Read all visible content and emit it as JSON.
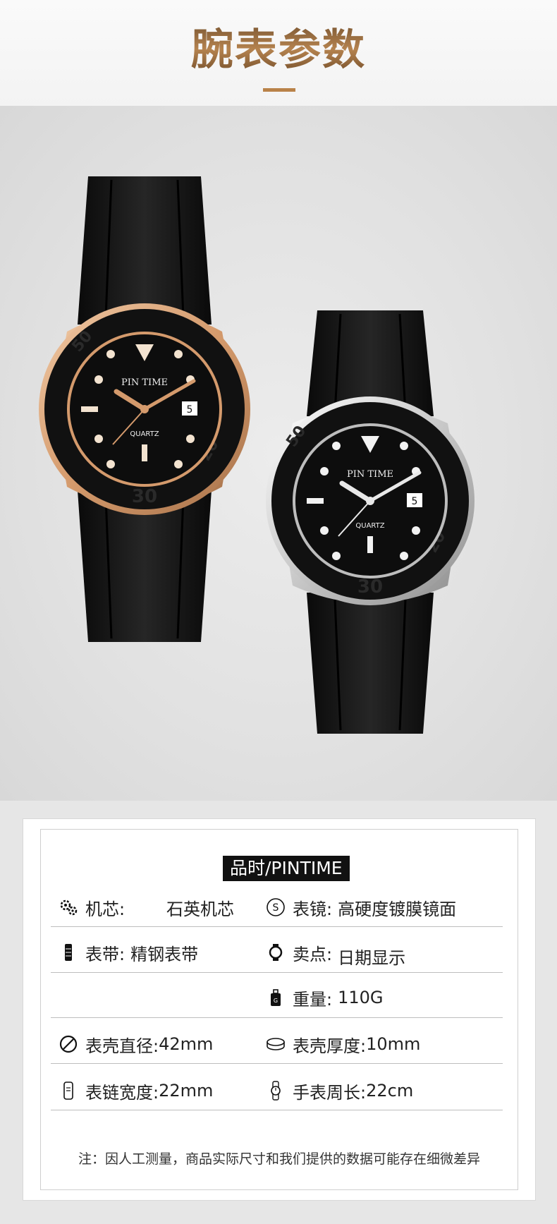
{
  "header": {
    "title": "腕表参数"
  },
  "watches": [
    {
      "name": "rose-gold-watch",
      "dial_brand": "PIN TIME",
      "dial_model": "QUARTZ",
      "date": "5"
    },
    {
      "name": "silver-watch",
      "dial_brand": "PIN TIME",
      "dial_model": "QUARTZ",
      "date": "5"
    }
  ],
  "specs": {
    "brand_label": "品时/PINTIME",
    "movement_label": "机芯:",
    "movement_value": "石英机芯",
    "mirror_label": "表镜:",
    "mirror_value": "高硬度镀膜镜面",
    "strap_label": "表带:",
    "strap_value": "精钢表带",
    "feature_label": "卖点:",
    "feature_value": "日期显示",
    "weight_label": "重量:",
    "weight_value": "110G",
    "diameter_label": "表壳直径:",
    "diameter_value": "42mm",
    "thickness_label": "表壳厚度:",
    "thickness_value": "10mm",
    "band_width_label": "表链宽度:",
    "band_width_value": "22mm",
    "wrist_label": "手表周长:",
    "wrist_value": "22cm",
    "note": "注：因人工测量，商品实际尺寸和我们提供的数据可能存在细微差异"
  },
  "colors": {
    "title_brown": "#9a6a3a",
    "accent_bar": "#b98248",
    "rose_gold": "#d9a57a",
    "steel": "#c8c8c8",
    "strap_black": "#111111"
  }
}
